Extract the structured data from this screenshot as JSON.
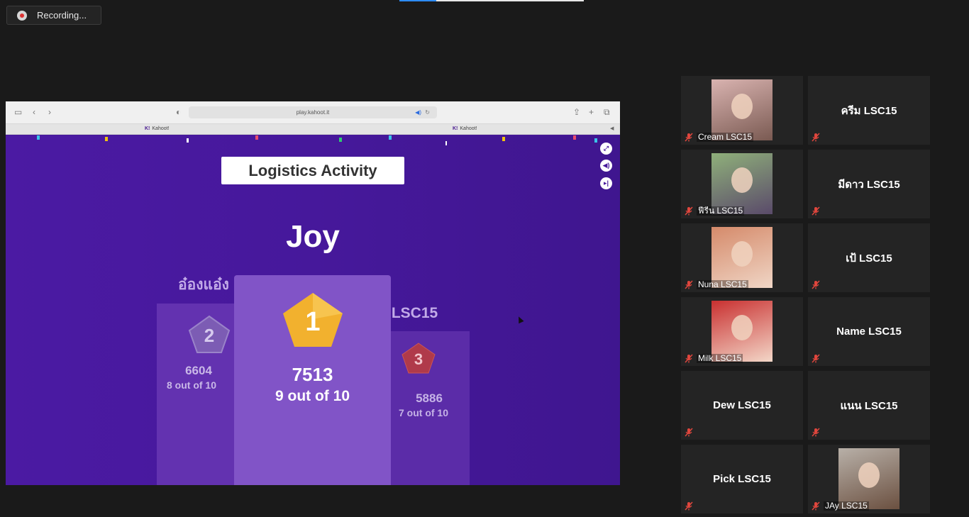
{
  "recording": {
    "label": "Recording..."
  },
  "browser": {
    "url": "play.kahoot.it",
    "tabs": [
      "Kahoot!",
      "Kahoot!"
    ]
  },
  "kahoot": {
    "title": "Logistics Activity",
    "winner_name": "Joy",
    "podium": {
      "first": {
        "rank": "1",
        "score": "7513",
        "result": "9 out of 10",
        "color": "#f2b12e"
      },
      "second": {
        "rank": "2",
        "name": "อ๋องแอ๋ง",
        "score": "6604",
        "result": "8 out of 10",
        "color": "#7c5cb4"
      },
      "third": {
        "rank": "3",
        "name": "มLSC15",
        "score": "5886",
        "result": "7 out of 10",
        "color": "#b03a4a"
      }
    },
    "accent": "#46189b"
  },
  "participants": [
    {
      "name": "Cream LSC15",
      "video": true
    },
    {
      "name": "ครีม LSC15",
      "video": false
    },
    {
      "name": "ฟีรีน LSC15",
      "video": true
    },
    {
      "name": "มีดาว LSC15",
      "video": false
    },
    {
      "name": "Nuna LSC15",
      "video": true
    },
    {
      "name": "เป้ LSC15",
      "video": false
    },
    {
      "name": "Milk LSC15",
      "video": true
    },
    {
      "name": "Name LSC15",
      "video": false
    },
    {
      "name": "Dew LSC15",
      "video": false
    },
    {
      "name": "แนน LSC15",
      "video": false
    },
    {
      "name": "Pick LSC15",
      "video": false
    },
    {
      "name": "JAy LSC15",
      "video": true
    }
  ]
}
